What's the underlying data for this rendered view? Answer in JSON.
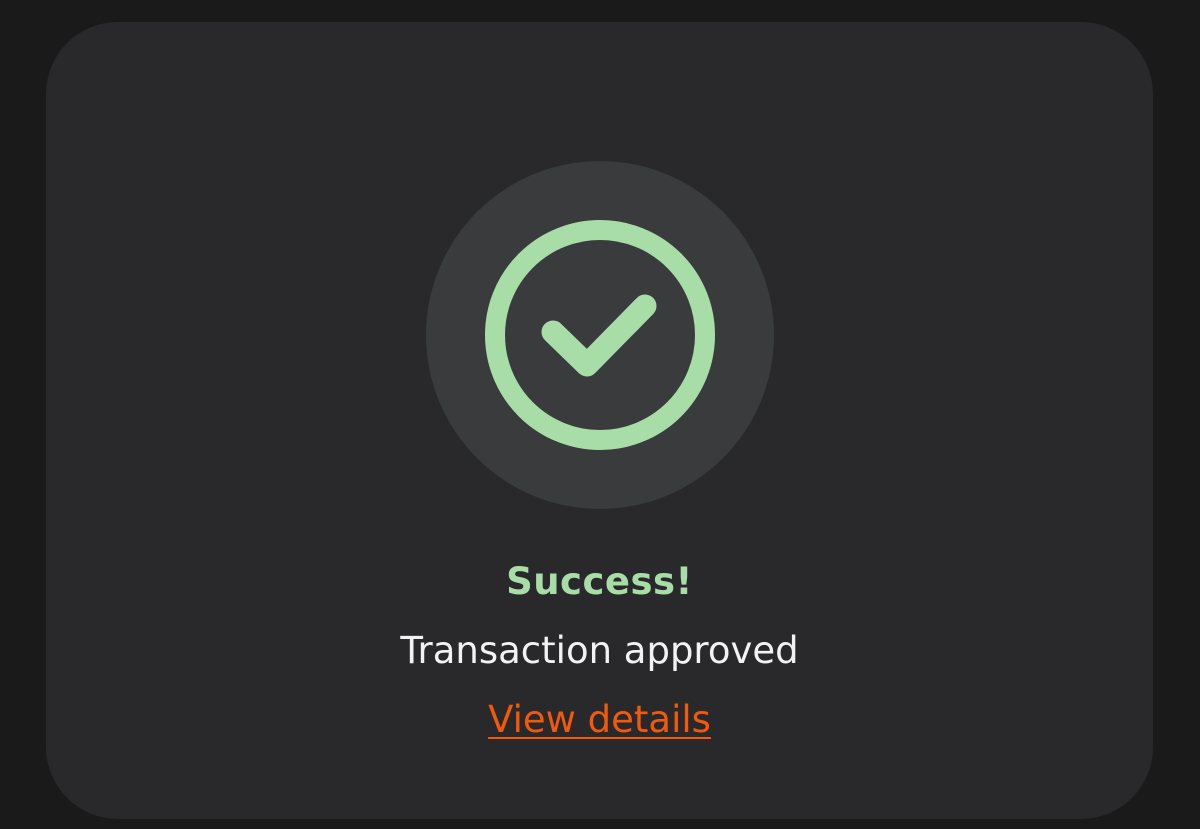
{
  "colors": {
    "page_background": "#1a1a1a",
    "card_background": "#29292b",
    "icon_background": "#3a3b3d",
    "success": "#a8dda8",
    "text": "#f2f2f2",
    "link": "#f05a0a"
  },
  "status": {
    "icon": "check-circle-icon",
    "title": "Success!",
    "message": "Transaction approved",
    "link_label": "View details"
  }
}
